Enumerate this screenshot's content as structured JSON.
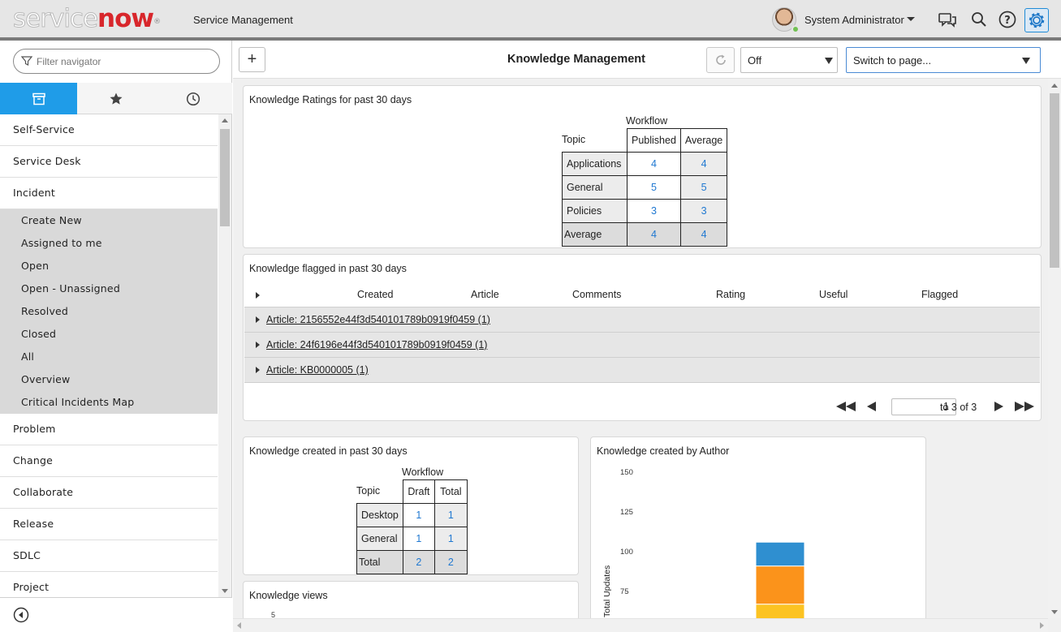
{
  "header": {
    "logo_part1": "service",
    "logo_part2": "now",
    "logo_mark": "®",
    "app_title": "Service Management",
    "user_name": "System Administrator",
    "icons": [
      "chat-icon",
      "search-icon",
      "help-icon",
      "gear-icon"
    ]
  },
  "nav": {
    "filter_placeholder": "Filter navigator",
    "tabs": [
      "all-apps-icon",
      "favorites-star-icon",
      "history-clock-icon"
    ],
    "items_before": [
      "Self-Service",
      "Service Desk",
      "Incident"
    ],
    "incident_modules": [
      "Create New",
      "Assigned to me",
      "Open",
      "Open - Unassigned",
      "Resolved",
      "Closed",
      "All",
      "Overview",
      "Critical Incidents Map"
    ],
    "items_after": [
      "Problem",
      "Change",
      "Collaborate",
      "Release",
      "SDLC",
      "Project"
    ]
  },
  "toolbar": {
    "add_label": "+",
    "page_title": "Knowledge Management",
    "refresh_value": "Off",
    "switch_placeholder": "Switch to page..."
  },
  "ratings": {
    "title": "Knowledge Ratings for past 30 days",
    "column_group": "Workflow",
    "row_label": "Topic",
    "columns": [
      "Published",
      "Average"
    ],
    "rows": [
      {
        "topic": "Applications",
        "values": [
          "4",
          "4"
        ]
      },
      {
        "topic": "General",
        "values": [
          "5",
          "5"
        ]
      },
      {
        "topic": "Policies",
        "values": [
          "3",
          "3"
        ]
      }
    ],
    "total": {
      "topic": "Average",
      "values": [
        "4",
        "4"
      ]
    }
  },
  "flagged": {
    "title": "Knowledge flagged in past 30 days",
    "columns": [
      "Created",
      "Article",
      "Comments",
      "Rating",
      "Useful",
      "Flagged"
    ],
    "groups": [
      "Article: 2156552e44f3d540101789b0919f0459 (1)",
      "Article: 24f6196e44f3d540101789b0919f0459 (1)",
      "Article: KB0000005 (1)"
    ],
    "pager": {
      "current_page": "1",
      "range_text": "to 3 of 3"
    }
  },
  "created": {
    "title": "Knowledge created in past 30 days",
    "column_group": "Workflow",
    "row_label": "Topic",
    "columns": [
      "Draft",
      "Total"
    ],
    "rows": [
      {
        "topic": "Desktop",
        "values": [
          "1",
          "1"
        ]
      },
      {
        "topic": "General",
        "values": [
          "1",
          "1"
        ]
      }
    ],
    "total": {
      "topic": "Total",
      "values": [
        "2",
        "2"
      ]
    }
  },
  "views": {
    "title": "Knowledge views",
    "first_tick": "5"
  },
  "chart_data": {
    "type": "bar",
    "title": "Knowledge created by Author",
    "ylabel": "Total Updates",
    "xlabel": "",
    "ylim": [
      50,
      150
    ],
    "yticks": [
      150,
      125,
      100,
      75
    ],
    "grid": false,
    "categories": [
      ""
    ],
    "series": [
      {
        "values": [
          47
        ],
        "color": "#fcc322"
      },
      {
        "values": [
          24
        ],
        "color": "#fb931b"
      },
      {
        "values": [
          15
        ],
        "color": "#2f8fd0"
      }
    ],
    "stacked": true
  }
}
